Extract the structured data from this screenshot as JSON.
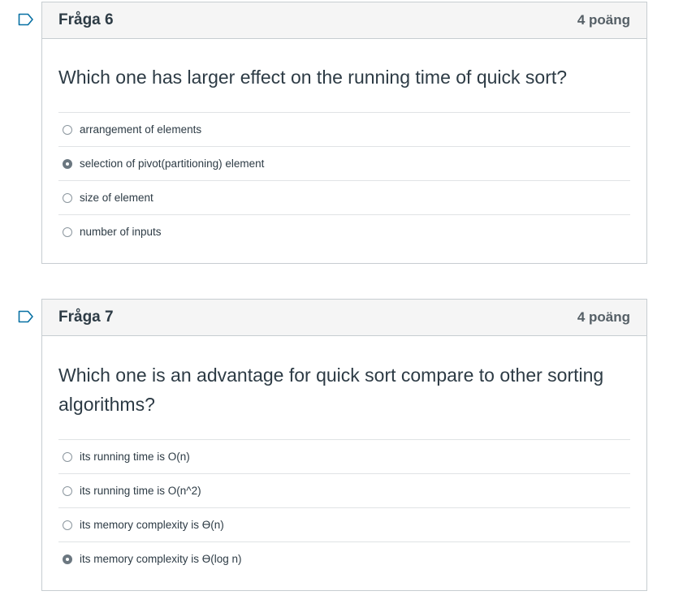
{
  "questions": [
    {
      "title": "Fråga 6",
      "points": "4 poäng",
      "text": "Which one has larger effect on the running time of quick sort?",
      "answers": [
        {
          "label": "arrangement of elements",
          "selected": false
        },
        {
          "label": "selection of pivot(partitioning) element",
          "selected": true
        },
        {
          "label": "size of element",
          "selected": false
        },
        {
          "label": "number of inputs",
          "selected": false
        }
      ]
    },
    {
      "title": "Fråga 7",
      "points": "4 poäng",
      "text": "Which one is an advantage for quick sort compare to other sorting algorithms?",
      "answers": [
        {
          "label": "its running time is O(n)",
          "selected": false
        },
        {
          "label": "its running time is O(n^2)",
          "selected": false
        },
        {
          "label": "its memory complexity is ϴ(n)",
          "selected": false
        },
        {
          "label": "its memory complexity is ϴ(log n)",
          "selected": true
        }
      ]
    }
  ],
  "colors": {
    "flag": "#0770a3",
    "border": "#c7cdd1",
    "header_bg": "#f5f5f5",
    "text": "#2d3b45",
    "radio_selected": "#6b7780"
  },
  "icons": {
    "flag": "flag-icon"
  }
}
